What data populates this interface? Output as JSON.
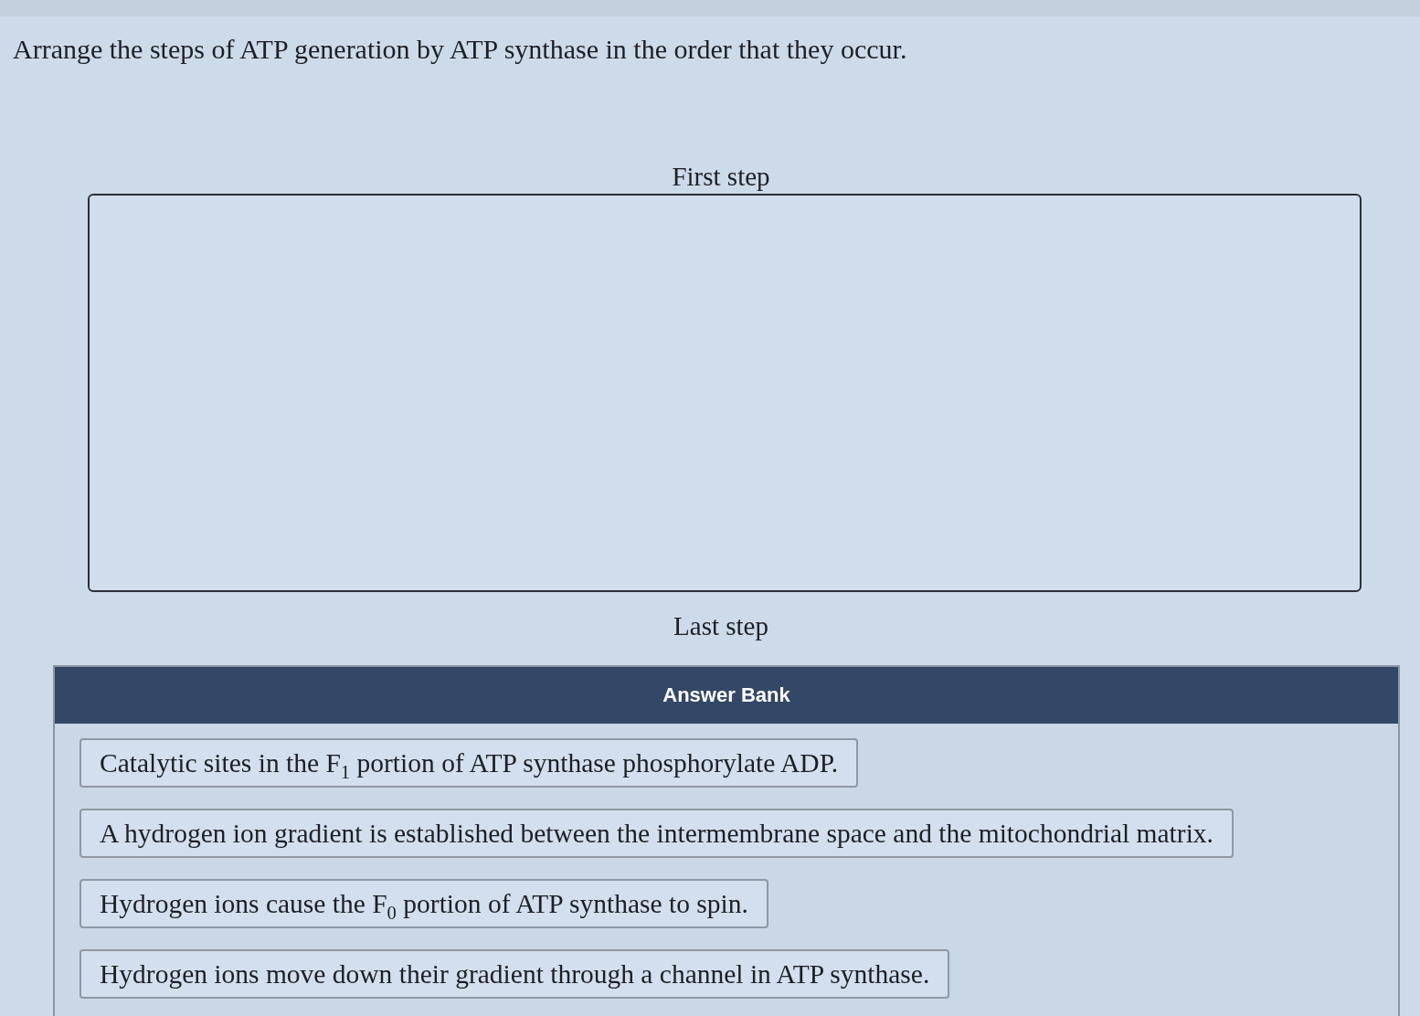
{
  "question": {
    "text": "Arrange the steps of ATP generation by ATP synthase in the order that they occur."
  },
  "ordering": {
    "top_label": "First step",
    "bottom_label": "Last step"
  },
  "answer_bank": {
    "title": "Answer Bank",
    "items": [
      {
        "text": "Catalytic sites in the F$_{1}$ portion of ATP synthase phosphorylate ADP."
      },
      {
        "text": "A hydrogen ion gradient is established between the intermembrane space and the mitochondrial matrix."
      },
      {
        "text": "Hydrogen ions cause the F$_{0}$ portion of ATP synthase to spin."
      },
      {
        "text": "Hydrogen ions move down their gradient through a channel in ATP synthase."
      }
    ]
  }
}
